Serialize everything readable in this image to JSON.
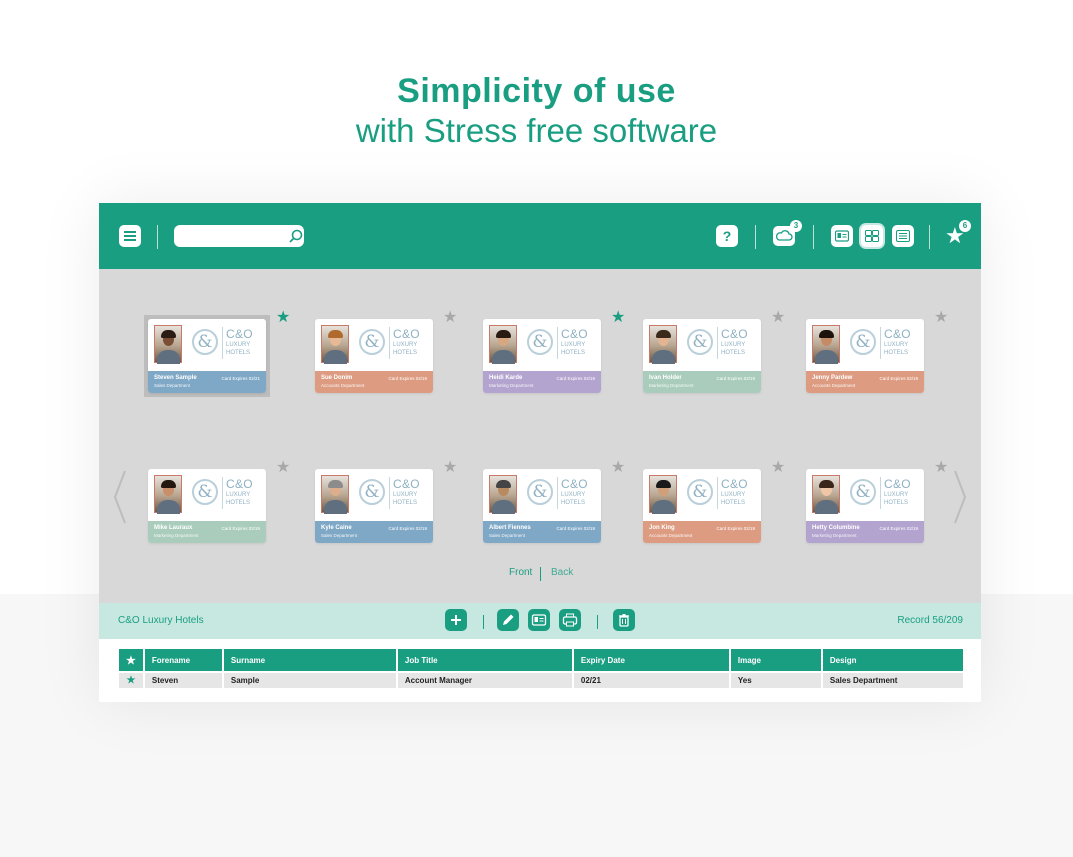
{
  "headline": {
    "title": "Simplicity of use",
    "subtitle": "with Stress free software"
  },
  "colors": {
    "accent": "#1a9e82",
    "band_blue": "#7fa8c7",
    "band_orange": "#dd9c82",
    "band_purple": "#b3a3cf",
    "band_green": "#a9ccbc",
    "star_inactive": "#a8a8a8"
  },
  "topbar": {
    "menu_icon": "hamburger-menu-icon",
    "search_placeholder": "",
    "search_icon": "search-icon",
    "help_label": "?",
    "cloud_badge": "3",
    "favorites_badge": "6"
  },
  "cards": [
    {
      "name": "Steven Sample",
      "dept": "Sales Department",
      "expiry": "Card Expires 02/21",
      "band": "blue",
      "starred": true,
      "selected": true,
      "hair": "#2b1d14",
      "skin": "#7a4e35"
    },
    {
      "name": "Sue Donim",
      "dept": "Accounts Department",
      "expiry": "Card Expires 02/19",
      "band": "orange",
      "starred": false,
      "selected": false,
      "hair": "#b06a2e",
      "skin": "#e7b995"
    },
    {
      "name": "Heidi Karde",
      "dept": "Marketing Department",
      "expiry": "Card Expires 02/19",
      "band": "purple",
      "starred": true,
      "selected": false,
      "hair": "#2a1b12",
      "skin": "#d7a782"
    },
    {
      "name": "Ivan Holder",
      "dept": "Marketing Department",
      "expiry": "Card Expires 02/19",
      "band": "green",
      "starred": false,
      "selected": false,
      "hair": "#3a2a1c",
      "skin": "#e2b491"
    },
    {
      "name": "Jenny Pardew",
      "dept": "Accounts Department",
      "expiry": "Card Expires 02/19",
      "band": "orange",
      "starred": false,
      "selected": false,
      "hair": "#1d120c",
      "skin": "#c48b66"
    },
    {
      "name": "Mike Lauraux",
      "dept": "Marketing Department",
      "expiry": "Card Expires 02/19",
      "band": "green",
      "starred": false,
      "selected": false,
      "hair": "#241810",
      "skin": "#c98e6a"
    },
    {
      "name": "Kyle Caine",
      "dept": "Sales Department",
      "expiry": "Card Expires 02/19",
      "band": "blue",
      "starred": false,
      "selected": false,
      "hair": "#8c8c8c",
      "skin": "#dcae8c"
    },
    {
      "name": "Albert Fiennes",
      "dept": "Sales Department",
      "expiry": "Card Expires 02/19",
      "band": "blue",
      "starred": false,
      "selected": false,
      "hair": "#444444",
      "skin": "#b98a60"
    },
    {
      "name": "Jon King",
      "dept": "Accounts Department",
      "expiry": "Card Expires 02/19",
      "band": "orange",
      "starred": false,
      "selected": false,
      "hair": "#1a1a1a",
      "skin": "#d19f79"
    },
    {
      "name": "Hetty Columbine",
      "dept": "Marketing Department",
      "expiry": "Card Expires 02/19",
      "band": "purple",
      "starred": false,
      "selected": false,
      "hair": "#3a261a",
      "skin": "#efc6a6"
    }
  ],
  "card_logo": {
    "monogram": "&",
    "line1": "C&O",
    "line2": "LUXURY",
    "line3": "HOTELS"
  },
  "side_tabs": {
    "front": "Front",
    "back": "Back"
  },
  "toolbar": {
    "title": "C&O Luxury Hotels",
    "record": "Record 56/209",
    "actions": [
      "add-icon",
      "edit-icon",
      "card-view-icon",
      "print-icon",
      "delete-icon"
    ]
  },
  "table": {
    "headers": [
      "★",
      "Forename",
      "Surname",
      "Job Title",
      "Expiry Date",
      "Image",
      "Design"
    ],
    "rows": [
      [
        "★",
        "Steven",
        "Sample",
        "Account Manager",
        "02/21",
        "Yes",
        "Sales Department"
      ]
    ]
  }
}
